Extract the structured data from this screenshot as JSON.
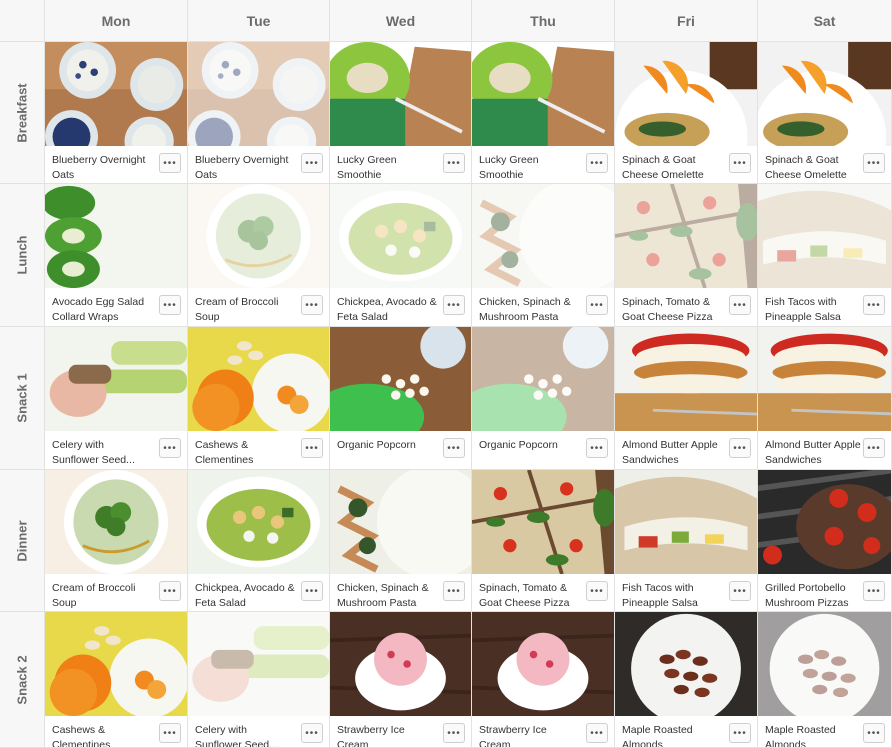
{
  "days": [
    "Mon",
    "Tue",
    "Wed",
    "Thu",
    "Fri",
    "Sat"
  ],
  "meals": [
    "Breakfast",
    "Lunch",
    "Snack 1",
    "Dinner",
    "Snack 2"
  ],
  "more_label": "•••",
  "plan": [
    [
      {
        "name": "Blueberry Overnight Oats",
        "photo": "oats-jars-photo",
        "faded": false
      },
      {
        "name": "Blueberry Overnight Oats",
        "photo": "oats-jars-photo",
        "faded": true
      },
      {
        "name": "Lucky Green Smoothie",
        "photo": "green-smoothie-photo",
        "faded": false
      },
      {
        "name": "Lucky Green Smoothie",
        "photo": "green-smoothie-photo",
        "faded": false
      },
      {
        "name": "Spinach & Goat Cheese Omelette",
        "photo": "omelette-photo",
        "faded": false
      },
      {
        "name": "Spinach & Goat Cheese Omelette",
        "photo": "omelette-photo",
        "faded": false
      }
    ],
    [
      {
        "name": "Avocado Egg Salad Collard Wraps",
        "photo": "collard-wraps-photo",
        "faded": false
      },
      {
        "name": "Cream of Broccoli Soup",
        "photo": "broccoli-soup-photo",
        "faded": true
      },
      {
        "name": "Chickpea, Avocado & Feta Salad",
        "photo": "chickpea-salad-photo",
        "faded": true
      },
      {
        "name": "Chicken, Spinach & Mushroom Pasta",
        "photo": "pasta-photo",
        "faded": true
      },
      {
        "name": "Spinach, Tomato & Goat Cheese Pizza",
        "photo": "pizza-photo",
        "faded": true
      },
      {
        "name": "Fish Tacos with Pineapple Salsa",
        "photo": "fish-tacos-photo",
        "faded": true
      }
    ],
    [
      {
        "name": "Celery with Sunflower Seed...",
        "photo": "celery-photo",
        "faded": false
      },
      {
        "name": "Cashews & Clementines",
        "photo": "cashews-clementines-photo",
        "faded": false
      },
      {
        "name": "Organic Popcorn",
        "photo": "popcorn-photo",
        "faded": false
      },
      {
        "name": "Organic Popcorn",
        "photo": "popcorn-photo",
        "faded": true
      },
      {
        "name": "Almond Butter Apple Sandwiches",
        "photo": "apple-sandwich-photo",
        "faded": false
      },
      {
        "name": "Almond Butter Apple Sandwiches",
        "photo": "apple-sandwich-photo",
        "faded": false
      }
    ],
    [
      {
        "name": "Cream of Broccoli Soup",
        "photo": "broccoli-soup-photo",
        "faded": false
      },
      {
        "name": "Chickpea, Avocado & Feta Salad",
        "photo": "chickpea-salad-photo",
        "faded": false
      },
      {
        "name": "Chicken, Spinach & Mushroom Pasta",
        "photo": "pasta-photo",
        "faded": false
      },
      {
        "name": "Spinach, Tomato & Goat Cheese Pizza",
        "photo": "pizza-photo",
        "faded": false
      },
      {
        "name": "Fish Tacos with Pineapple Salsa",
        "photo": "fish-tacos-photo",
        "faded": false
      },
      {
        "name": "Grilled Portobello Mushroom Pizzas",
        "photo": "portobello-photo",
        "faded": false
      }
    ],
    [
      {
        "name": "Cashews & Clementines",
        "photo": "cashews-clementines-photo",
        "faded": false
      },
      {
        "name": "Celery with Sunflower Seed...",
        "photo": "celery-photo",
        "faded": true
      },
      {
        "name": "Strawberry Ice Cream",
        "photo": "ice-cream-photo",
        "faded": false
      },
      {
        "name": "Strawberry Ice Cream",
        "photo": "ice-cream-photo",
        "faded": false
      },
      {
        "name": "Maple Roasted Almonds",
        "photo": "almonds-photo",
        "faded": false
      },
      {
        "name": "Maple Roasted Almonds",
        "photo": "almonds-photo",
        "faded": true
      }
    ]
  ]
}
